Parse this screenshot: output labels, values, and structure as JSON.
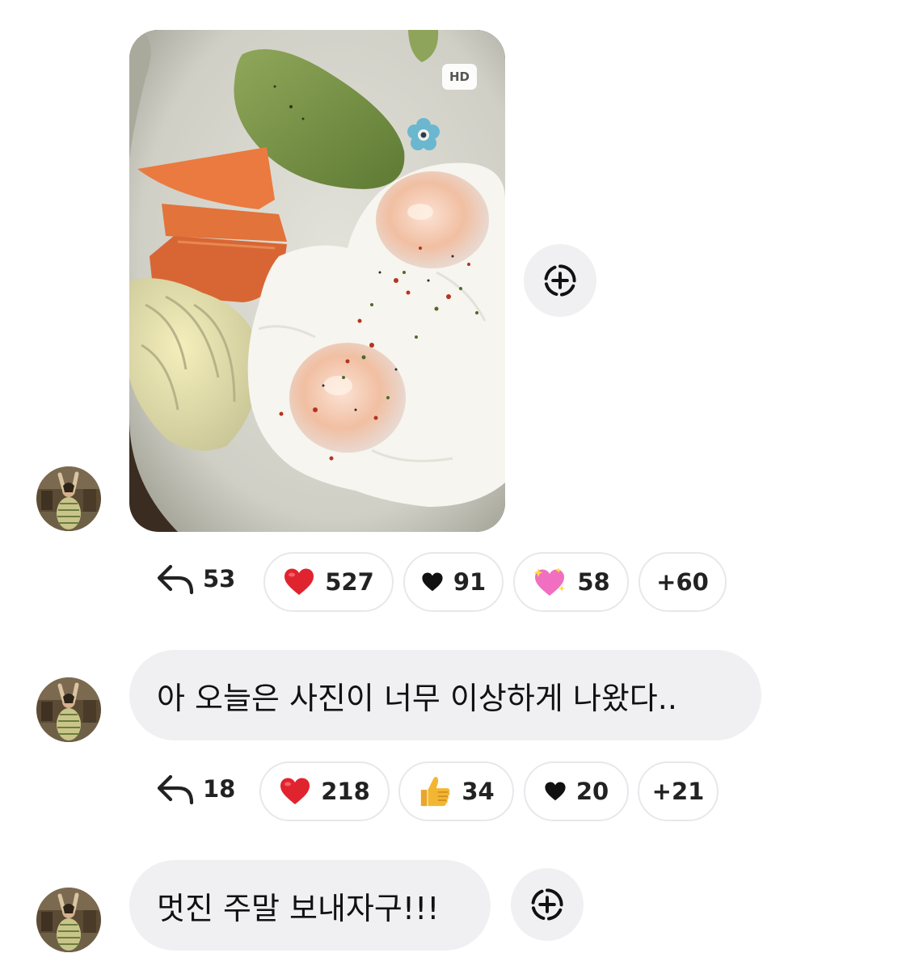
{
  "messages": [
    {
      "type": "photo",
      "badge": "HD",
      "reactions": {
        "reply_count": "53",
        "items": [
          {
            "emoji": "red-heart",
            "count": "527"
          },
          {
            "emoji": "black-heart",
            "count": "91"
          },
          {
            "emoji": "sparkling-heart",
            "count": "58"
          }
        ],
        "more": "+60"
      }
    },
    {
      "type": "text",
      "text": "아 오늘은 사진이 너무 이상하게 나왔다..",
      "reactions": {
        "reply_count": "18",
        "items": [
          {
            "emoji": "red-heart",
            "count": "218"
          },
          {
            "emoji": "thumbs-up",
            "count": "34"
          },
          {
            "emoji": "black-heart",
            "count": "20"
          }
        ],
        "more": "+21"
      }
    },
    {
      "type": "text",
      "text": "멋진 주말 보내자구!!!"
    }
  ],
  "colors": {
    "bubble_bg": "#f0f0f3",
    "pill_border": "#e8e8ec",
    "red_heart": "#e0242f",
    "thumbs_up": "#f2b632"
  }
}
